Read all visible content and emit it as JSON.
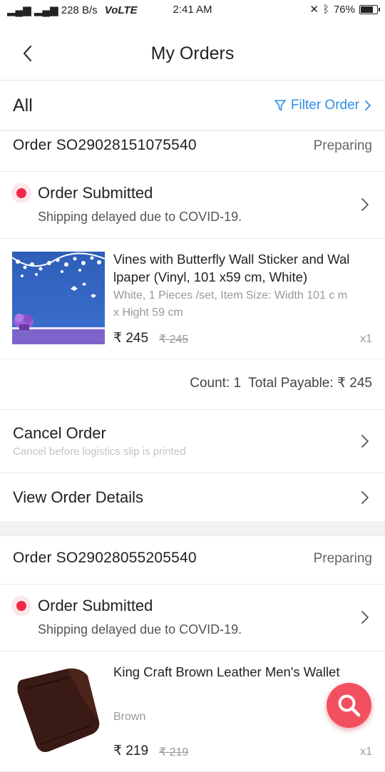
{
  "status_bar": {
    "network": "228 B/s",
    "volte": "VoLTE",
    "time": "2:41 AM",
    "battery": "76%",
    "battery_level": 0.76
  },
  "header": {
    "title": "My Orders"
  },
  "filter_bar": {
    "all_label": "All",
    "filter_label": "Filter Order"
  },
  "orders": [
    {
      "order_number": "Order SO29028151075540",
      "state": "Preparing",
      "status_label": "Order Submitted",
      "status_note": "Shipping delayed due to COVID-19.",
      "product": {
        "name": "Vines with Butterfly Wall Sticker and Wal lpaper (Vinyl, 101 x59 cm, White)",
        "spec": "White, 1 Pieces /set, Item Size: Width 101 c m x Hight 59 cm",
        "price": "₹ 245",
        "original_price": "₹ 245",
        "quantity": "x1"
      },
      "summary": "Count: 1  Total Payable: ₹ 245",
      "cancel_label": "Cancel Order",
      "cancel_hint": "Cancel before logistics slip is printed",
      "details_label": "View Order Details"
    },
    {
      "order_number": "Order SO29028055205540",
      "state": "Preparing",
      "status_label": "Order Submitted",
      "status_note": "Shipping delayed due to COVID-19.",
      "product": {
        "name": "King Craft Brown Leather Men's Wallet",
        "spec": "Brown",
        "price": "₹ 219",
        "original_price": "₹ 219",
        "quantity": "x1"
      }
    }
  ],
  "colors": {
    "accent_blue": "#2d8fe6",
    "status_red": "#ee2a48",
    "fab_red": "#f2505f"
  },
  "icons": {
    "back": "chevron-left-icon",
    "filter": "funnel-icon",
    "chevron": "chevron-right-icon",
    "search": "search-icon"
  }
}
